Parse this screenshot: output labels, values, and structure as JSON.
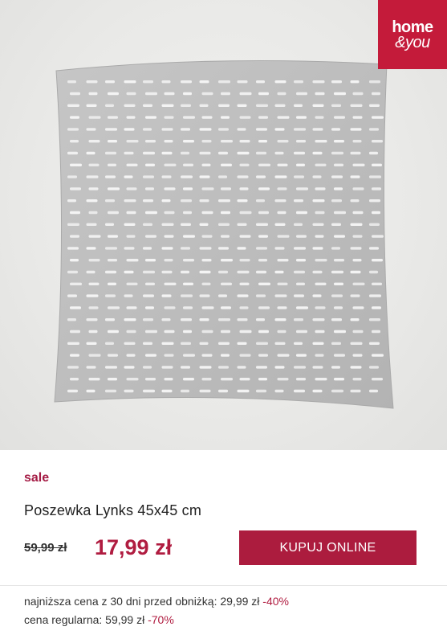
{
  "brand": {
    "line1": "home",
    "line2": "&you",
    "color": "#c41b3a"
  },
  "product": {
    "badge": "sale",
    "name": "Poszewka Lynks 45x45 cm",
    "old_price": "59,99 zł",
    "new_price": "17,99 zł",
    "buy_label": "KUPUJ ONLINE"
  },
  "notes": {
    "lowest_label": "najniższa cena z 30 dni przed obniżką: 29,99 zł",
    "lowest_pct": "-40%",
    "regular_label": "cena regularna: 59,99 zł",
    "regular_pct": "-70%"
  },
  "colors": {
    "accent": "#ac1c3e",
    "sale": "#a51c45",
    "pillow": "#bcbcbc"
  }
}
